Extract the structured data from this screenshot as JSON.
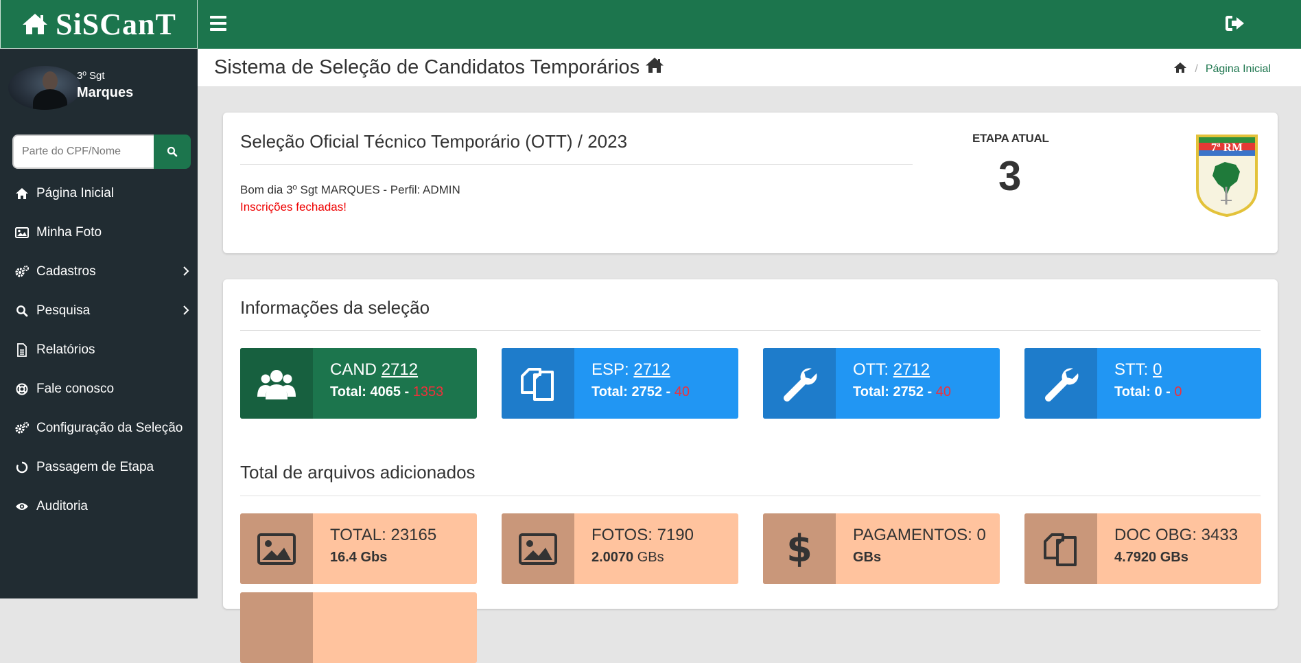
{
  "app": {
    "brand": "SiSCanT"
  },
  "user": {
    "rank": "3º Sgt",
    "name": "Marques"
  },
  "search": {
    "placeholder": "Parte do CPF/Nome"
  },
  "sidebar": {
    "items": [
      {
        "label": "Página Inicial",
        "icon": "home-icon"
      },
      {
        "label": "Minha Foto",
        "icon": "image-icon"
      },
      {
        "label": "Cadastros",
        "icon": "cogs-icon",
        "submenu": true
      },
      {
        "label": "Pesquisa",
        "icon": "search-icon",
        "submenu": true
      },
      {
        "label": "Relatórios",
        "icon": "file-icon"
      },
      {
        "label": "Fale conosco",
        "icon": "lifebuoy-icon"
      },
      {
        "label": "Configuração da Seleção",
        "icon": "cogs-icon"
      },
      {
        "label": "Passagem de Etapa",
        "icon": "circle-notch-icon"
      },
      {
        "label": "Auditoria",
        "icon": "eye-icon"
      }
    ]
  },
  "header": {
    "title": "Sistema de Seleção de Candidatos Temporários",
    "breadcrumb": "Página Inicial"
  },
  "selection": {
    "title": "Seleção Oficial Técnico Temporário (OTT) / 2023",
    "greeting": "Bom dia 3º Sgt MARQUES - Perfil: ADMIN",
    "status": "Inscrições fechadas!",
    "stage_label": "ETAPA ATUAL",
    "stage_value": "3",
    "emblem_text": "7ª RM"
  },
  "info": {
    "title": "Informações da seleção",
    "boxes": [
      {
        "label": "CAND",
        "count": "2712",
        "total_label": "Total: 4065 -",
        "total_red": "1353",
        "icon": "users-icon",
        "color": "green"
      },
      {
        "label": "ESP:",
        "count": "2712",
        "total_label": "Total: 2752 -",
        "total_red": "40",
        "icon": "copy-icon",
        "color": "blue"
      },
      {
        "label": "OTT:",
        "count": "2712",
        "total_label": "Total: 2752 -",
        "total_red": "40",
        "icon": "wrench-icon",
        "color": "blue"
      },
      {
        "label": "STT:",
        "count": "0",
        "total_label": "Total: 0 -",
        "total_red": "0",
        "icon": "wrench-icon",
        "color": "blue"
      }
    ]
  },
  "files": {
    "title": "Total de arquivos adicionados",
    "boxes": [
      {
        "label": "TOTAL: 23165",
        "size": "16.4 Gbs",
        "unit": "",
        "icon": "image-icon"
      },
      {
        "label": "FOTOS: 7190",
        "size": "2.0070",
        "unit": "GBs",
        "icon": "image-icon"
      },
      {
        "label": "PAGAMENTOS: 0",
        "size": "GBs",
        "unit": "",
        "icon": "dollar-icon"
      },
      {
        "label": "DOC OBG: 3433",
        "size": "4.7920 GBs",
        "unit": "",
        "icon": "copy-icon"
      }
    ]
  },
  "colors": {
    "primary": "#1c754d",
    "sidebar": "#212c32",
    "info_blue": "#2196f3",
    "peach": "#ffc39e",
    "alert": "#e00000"
  }
}
